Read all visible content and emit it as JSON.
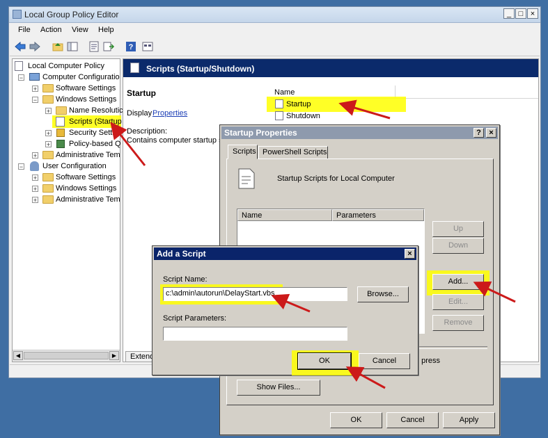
{
  "main_window": {
    "title": "Local Group Policy Editor",
    "menu": [
      "File",
      "Action",
      "View",
      "Help"
    ]
  },
  "tree": {
    "items": [
      {
        "label": "Local Computer Policy"
      },
      {
        "label": "Computer Configuratio"
      },
      {
        "label": "Software Settings"
      },
      {
        "label": "Windows Settings"
      },
      {
        "label": "Name Resolutic"
      },
      {
        "label": "Scripts (Startup"
      },
      {
        "label": "Security Settir"
      },
      {
        "label": "Policy-based Q"
      },
      {
        "label": "Administrative Tem"
      },
      {
        "label": "User Configuration"
      },
      {
        "label": "Software Settings"
      },
      {
        "label": "Windows Settings"
      },
      {
        "label": "Administrative Tem"
      }
    ]
  },
  "content": {
    "header_title": "Scripts (Startup/Shutdown)",
    "section_title": "Startup",
    "display_text": "Display",
    "properties_link": "Properties",
    "description_label": "Description:",
    "description_text": "Contains computer startup s",
    "list_header": "Name",
    "list_items": [
      "Startup",
      "Shutdown"
    ],
    "bottom_tab": "Extend"
  },
  "startup_properties": {
    "title": "Startup Properties",
    "help_btn": "?",
    "close_btn": "×",
    "tabs": [
      "Scripts",
      "PowerShell Scripts"
    ],
    "heading": "Startup Scripts for Local Computer",
    "columns": [
      "Name",
      "Parameters"
    ],
    "buttons": {
      "up": "Up",
      "down": "Down",
      "add": "Add...",
      "edit": "Edit...",
      "remove": "Remove",
      "show_files": "Show Files..."
    },
    "partial_text": ", press",
    "footer": {
      "ok": "OK",
      "cancel": "Cancel",
      "apply": "Apply"
    }
  },
  "add_script": {
    "title": "Add a Script",
    "close_btn": "×",
    "script_name_label": "Script Name:",
    "script_name_value": "c:\\admin\\autorun\\DelayStart.vbs",
    "browse": "Browse...",
    "params_label": "Script Parameters:",
    "params_value": "",
    "ok": "OK",
    "cancel": "Cancel"
  },
  "colors": {
    "highlight": "#ffff00",
    "arrow": "#cc1a1a",
    "header_bar": "#0b2a6b",
    "active_title": "#0a246a"
  }
}
